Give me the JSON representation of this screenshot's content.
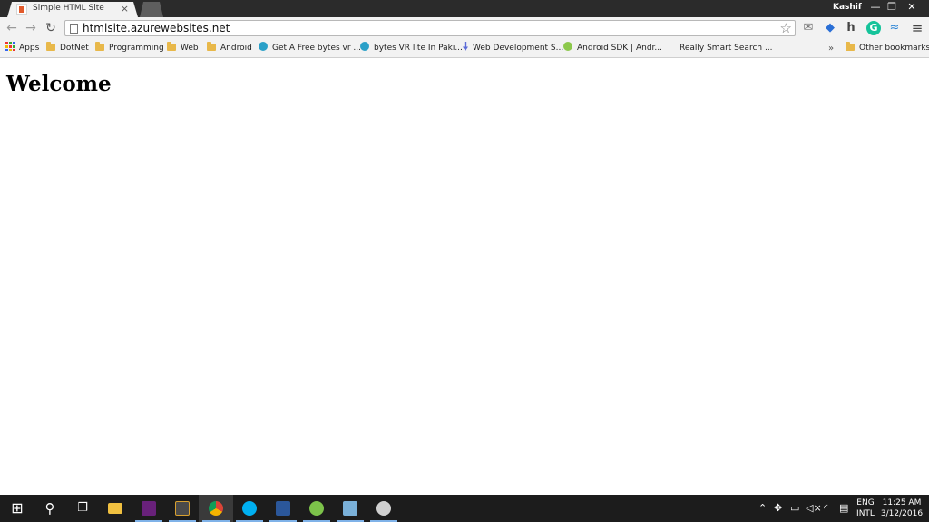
{
  "window": {
    "user_name": "Kashif",
    "minimize_glyph": "—",
    "restore_glyph": "❐",
    "close_glyph": "✕"
  },
  "tabs": [
    {
      "title": "Simple HTML Site",
      "close_glyph": "×",
      "active": true
    }
  ],
  "toolbar": {
    "back_glyph": "←",
    "forward_glyph": "→",
    "reload_glyph": "↻",
    "url": "htmlsite.azurewebsites.net",
    "star_glyph": "☆",
    "menu_glyph": "≡",
    "extensions": [
      {
        "name": "gmail-icon",
        "glyph": "✉",
        "color": "#777777"
      },
      {
        "name": "dropbox-icon",
        "glyph": "◆",
        "color": "#2a6fd6"
      },
      {
        "name": "hola-icon",
        "glyph": "h",
        "color": "#444444"
      },
      {
        "name": "grammarly-icon",
        "glyph": "G",
        "color": "#15c39a"
      },
      {
        "name": "wave-icon",
        "glyph": "≈",
        "color": "#2a84d6"
      }
    ]
  },
  "bookmarks": {
    "items": [
      {
        "label": "Apps",
        "kind": "apps"
      },
      {
        "label": "DotNet",
        "kind": "folder"
      },
      {
        "label": "Programming",
        "kind": "folder"
      },
      {
        "label": "Web",
        "kind": "folder"
      },
      {
        "label": "Android",
        "kind": "folder"
      },
      {
        "label": "Get A Free bytes vr ...",
        "kind": "page",
        "color": "#2aa0c8"
      },
      {
        "label": "bytes VR lite In Paki...",
        "kind": "page",
        "color": "#2aa0c8"
      },
      {
        "label": "Web Development S...",
        "kind": "page",
        "color": "#5b6bd8"
      },
      {
        "label": "Android SDK | Andr...",
        "kind": "page",
        "color": "#8cc84b"
      },
      {
        "label": "Really Smart Search ...",
        "kind": "blank"
      }
    ],
    "overflow_glyph": "»",
    "other_label": "Other bookmarks"
  },
  "page": {
    "heading": "Welcome"
  },
  "taskbar": {
    "apps": [
      {
        "name": "start-button",
        "glyph": "⊞",
        "color": "#ffffff"
      },
      {
        "name": "search-button",
        "glyph": "⚲",
        "color": "#ffffff"
      },
      {
        "name": "task-view-button",
        "glyph": "❐",
        "color": "#ffffff"
      },
      {
        "name": "file-explorer-button",
        "glyph": "",
        "color": "#f0c040"
      },
      {
        "name": "visual-studio-button",
        "glyph": "∞",
        "color": "#68217a"
      },
      {
        "name": "tools-button",
        "glyph": "⚒",
        "color": "#d8a030"
      },
      {
        "name": "chrome-button",
        "glyph": "◉",
        "color": "#e04a3a"
      },
      {
        "name": "skype-button",
        "glyph": "S",
        "color": "#00aff0"
      },
      {
        "name": "word-button",
        "glyph": "W",
        "color": "#2b579a"
      },
      {
        "name": "notepad-plus-button",
        "glyph": "✎",
        "color": "#7cc24a"
      },
      {
        "name": "database-button",
        "glyph": "≣",
        "color": "#7ab0d8"
      },
      {
        "name": "paint-button",
        "glyph": "✿",
        "color": "#d0d0d0"
      }
    ],
    "tray": {
      "language": "ENG",
      "layout": "INTL",
      "time": "11:25 AM",
      "date": "3/12/2016"
    }
  }
}
